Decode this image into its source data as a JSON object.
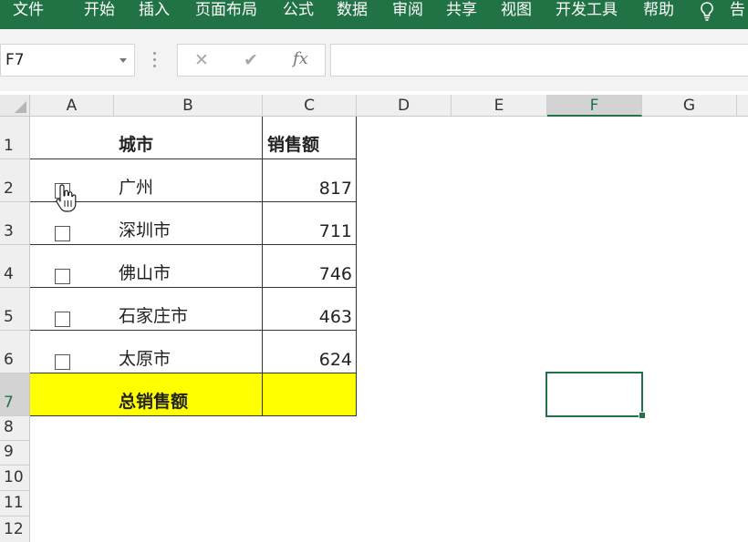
{
  "ribbon": {
    "tabs": [
      "文件",
      "开始",
      "插入",
      "页面布局",
      "公式",
      "数据",
      "审阅",
      "共享",
      "视图",
      "开发工具",
      "帮助"
    ],
    "tell_me": "告"
  },
  "name_box": {
    "value": "F7"
  },
  "formula_bar": {
    "cancel_icon": "✕",
    "enter_icon": "✔",
    "fx_label": "fx",
    "value": ""
  },
  "columns": [
    "A",
    "B",
    "C",
    "D",
    "E",
    "F",
    "G"
  ],
  "selected_column": "F",
  "rows": [
    "1",
    "2",
    "3",
    "4",
    "5",
    "6",
    "7",
    "8",
    "9",
    "10",
    "11",
    "12"
  ],
  "selected_row": "7",
  "active_cell": "F7",
  "table": {
    "header": {
      "city": "城市",
      "sales": "销售额"
    },
    "data": [
      {
        "city": "广州",
        "sales": "817",
        "checked": false
      },
      {
        "city": "深圳市",
        "sales": "711",
        "checked": false
      },
      {
        "city": "佛山市",
        "sales": "746",
        "checked": false
      },
      {
        "city": "石家庄市",
        "sales": "463",
        "checked": false
      },
      {
        "city": "太原市",
        "sales": "624",
        "checked": false
      }
    ],
    "total_label": "总销售额",
    "total_value": ""
  },
  "colors": {
    "ribbon": "#217346",
    "accent": "#217346",
    "total_fill": "#ffff00"
  }
}
